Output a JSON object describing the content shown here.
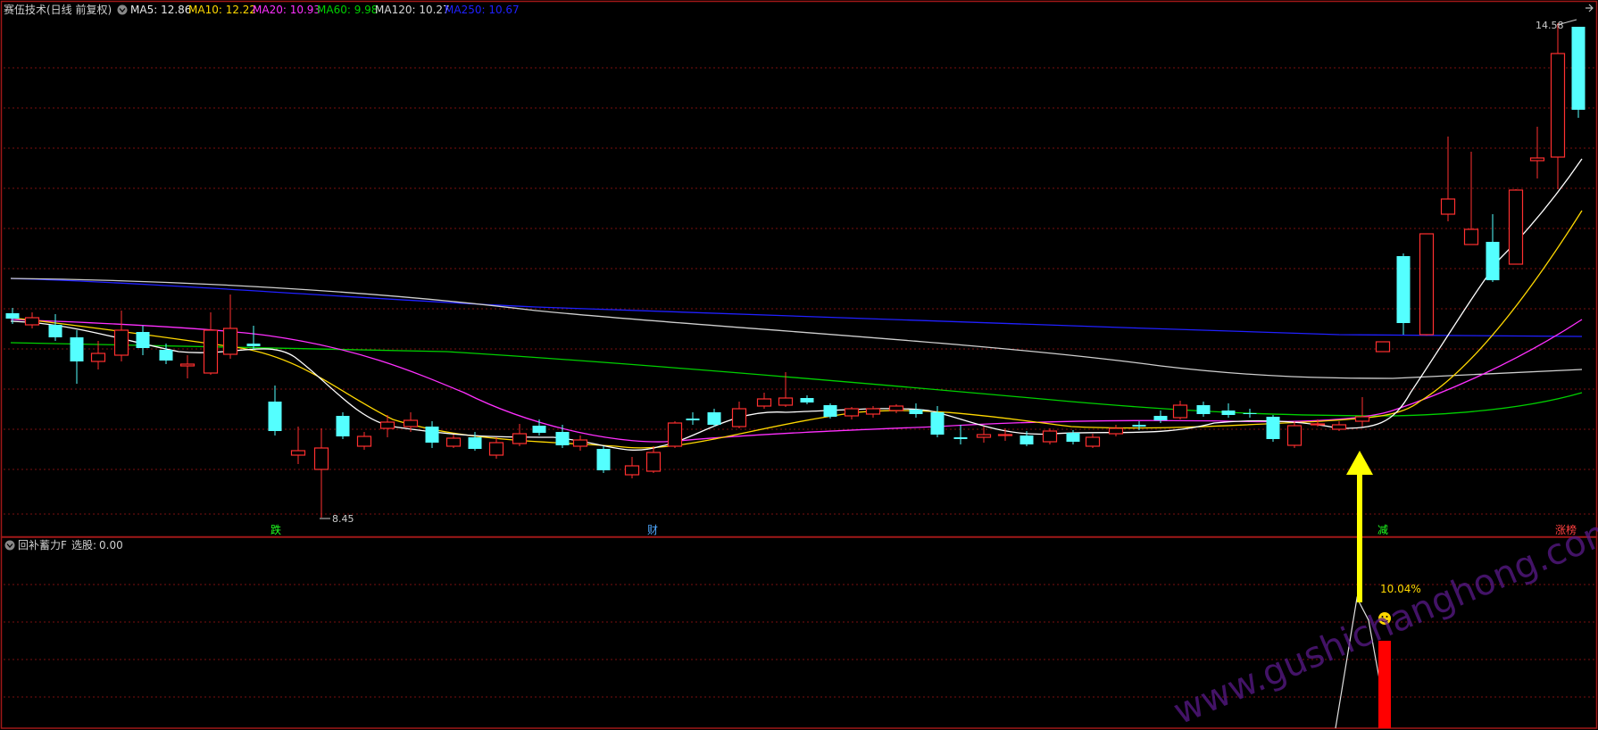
{
  "main_panel": {
    "title": "赛伍技术(日线 前复权)",
    "ma_labels": [
      {
        "name": "MA5",
        "value": "12.86",
        "color": "#e8e8e8"
      },
      {
        "name": "MA10",
        "value": "12.22",
        "color": "#ffd800"
      },
      {
        "name": "MA20",
        "value": "10.93",
        "color": "#ff30ff"
      },
      {
        "name": "MA60",
        "value": "9.98",
        "color": "#00d000"
      },
      {
        "name": "MA120",
        "value": "10.27",
        "color": "#d8d8d8"
      },
      {
        "name": "MA250",
        "value": "10.67",
        "color": "#2020ff"
      }
    ],
    "high_marker": "14.58",
    "low_marker": "8.45",
    "event_markers": [
      {
        "text": "跌",
        "color": "#20ff20"
      },
      {
        "text": "财",
        "color": "#4fa8ff"
      },
      {
        "text": "减",
        "color": "#20ff20"
      },
      {
        "text": "涨榜",
        "color": "#ff4040"
      }
    ]
  },
  "indicator_panel": {
    "title": "回补蓄力F",
    "selection_label": "选股:",
    "selection_value": "0.00",
    "percent_label": "10.04%",
    "smiley_icon": "smiley-icon"
  },
  "watermark": "www.gushichanghong.com",
  "colors": {
    "up": "#ff3030",
    "down": "#54ffff",
    "arrow": "#ffff00",
    "panel_border": "#a01818",
    "grid": "#7a1010",
    "signal_bar": "#ff0000"
  }
}
